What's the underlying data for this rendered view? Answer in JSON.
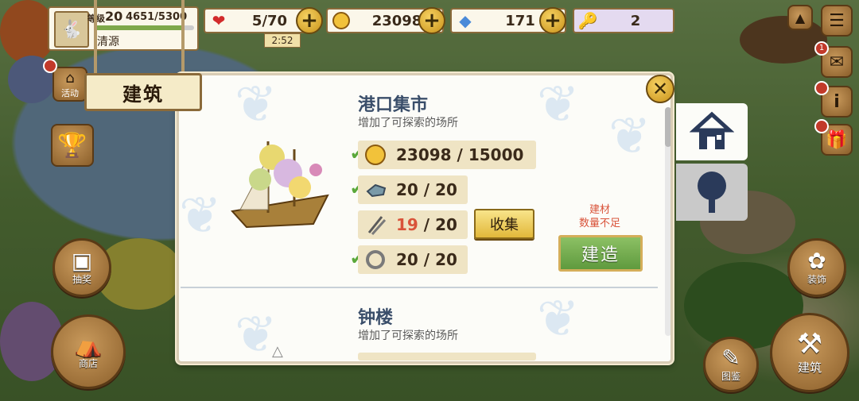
{
  "player": {
    "level_label": "等级",
    "level": "20",
    "xp": "4651/5300",
    "xp_fraction": 0.878,
    "name": "清源"
  },
  "resources": {
    "hearts": "5/70",
    "coins": "23098",
    "gems": "171",
    "keys": "2",
    "timer": "2:52"
  },
  "left_buttons": {
    "event": "活动",
    "lottery": "抽奖",
    "shop": "商店"
  },
  "right_buttons": {
    "mail_badge": "1",
    "decorate": "装饰",
    "collection": "图鉴",
    "build": "建筑"
  },
  "panel": {
    "header": "建筑",
    "items": [
      {
        "title": "港口集市",
        "desc": "增加了可探索的场所",
        "requirements": [
          {
            "icon": "coin",
            "have": "23098",
            "sep": " / ",
            "need": "15000",
            "met": true
          },
          {
            "icon": "stone",
            "have": "20",
            "sep": " / ",
            "need": "20",
            "met": true
          },
          {
            "icon": "nails",
            "have": "19",
            "sep": " / ",
            "need": "20",
            "met": false
          },
          {
            "icon": "rope",
            "have": "20",
            "sep": " / ",
            "need": "20",
            "met": true
          }
        ],
        "collect_label": "收集",
        "warning_line1": "建材",
        "warning_line2": "数量不足",
        "build_label": "建造"
      },
      {
        "title": "钟楼",
        "desc": "增加了可探索的场所"
      }
    ]
  },
  "colors": {
    "accent_gold": "#e2b83a",
    "build_green": "#6fa84a",
    "shortage_red": "#d9533a",
    "title_blue": "#3a4e6a"
  }
}
